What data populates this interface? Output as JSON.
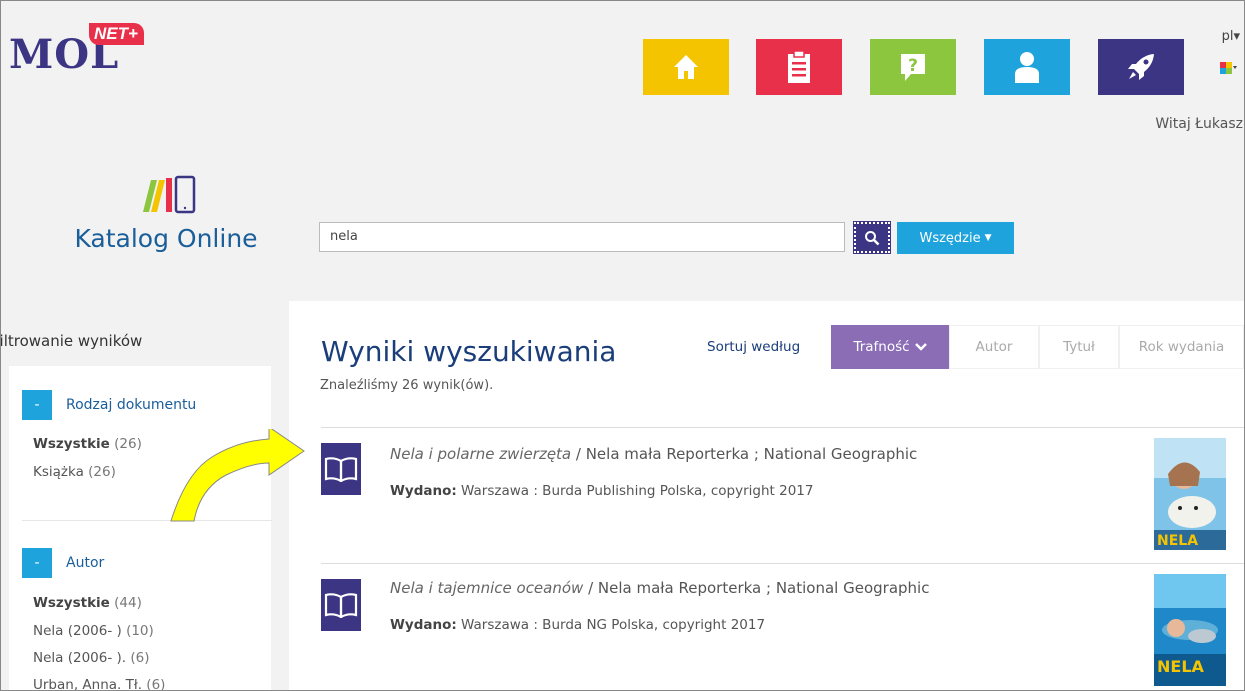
{
  "app": {
    "logo_text": "MOL",
    "logo_badge": "NET+",
    "nav_tiles": [
      {
        "icon": "home-icon",
        "color": "#f5c400"
      },
      {
        "icon": "clipboard-icon",
        "color": "#e8304b"
      },
      {
        "icon": "help-icon",
        "color": "#8cc63f"
      },
      {
        "icon": "user-icon",
        "color": "#1ea3dc"
      },
      {
        "icon": "rocket-icon",
        "color": "#3b3584"
      }
    ],
    "language": "pl",
    "welcome": "Witaj Łukasz"
  },
  "catalog": {
    "title": "Katalog Online"
  },
  "search": {
    "value": "nela",
    "scope_label": "Wszędzie"
  },
  "sidebar": {
    "title": "Filtrowanie wyników",
    "sections": [
      {
        "label": "Rodzaj dokumentu",
        "toggle": "-",
        "items": [
          {
            "label": "Wszystkie",
            "count": "(26)",
            "bold": true
          },
          {
            "label": "Książka",
            "count": "(26)",
            "bold": false
          }
        ]
      },
      {
        "label": "Autor",
        "toggle": "-",
        "items": [
          {
            "label": "Wszystkie",
            "count": "(44)",
            "bold": true
          },
          {
            "label": "Nela (2006- )",
            "count": "(10)",
            "bold": false
          },
          {
            "label": "Nela (2006- ).",
            "count": "(6)",
            "bold": false
          },
          {
            "label": "Urban, Anna. Tł.",
            "count": "(6)",
            "bold": false
          }
        ]
      }
    ]
  },
  "results": {
    "heading": "Wyniki wyszukiwania",
    "sort_label": "Sortuj według",
    "sort_options": [
      "Trafność",
      "Autor",
      "Tytuł",
      "Rok wydania"
    ],
    "active_sort": "Trafność",
    "found_text": "Znaleźliśmy 26 wynik(ów).",
    "items": [
      {
        "title": "Nela i polarne zwierzęta",
        "responsibility": " / Nela mała Reporterka ; National Geographic",
        "published_label": "Wydano:",
        "published": " Warszawa : Burda Publishing Polska, copyright 2017",
        "cover_text": "NELA"
      },
      {
        "title": "Nela i tajemnice oceanów",
        "responsibility": " / Nela mała Reporterka ; National Geographic",
        "published_label": "Wydano:",
        "published": " Warszawa : Burda NG Polska, copyright 2017",
        "cover_text": "NELA"
      }
    ]
  },
  "colors": {
    "brand_purple": "#3b3584",
    "accent_blue": "#1ea3dc",
    "sort_active": "#8a6db5",
    "annotation_arrow": "#ffff00"
  }
}
